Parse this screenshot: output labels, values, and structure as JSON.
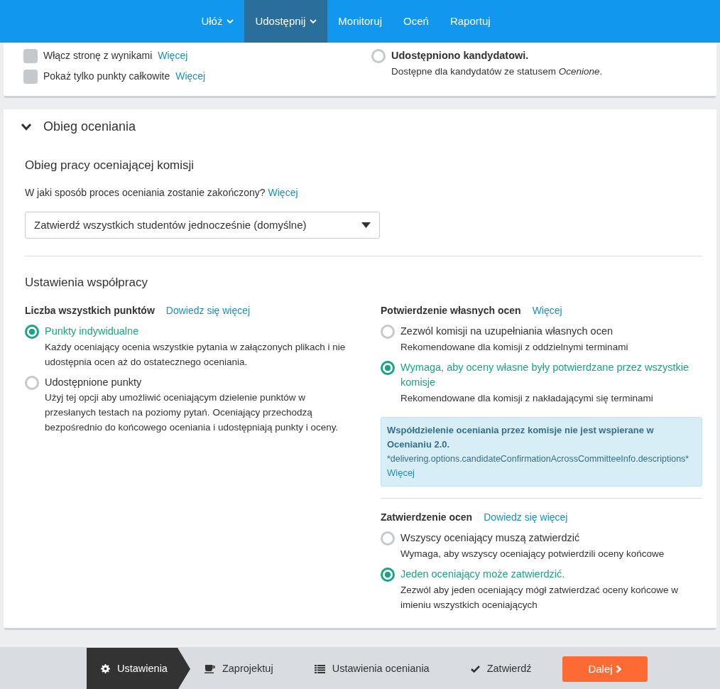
{
  "nav": {
    "items": [
      {
        "label": "Ułóż",
        "dropdown": true,
        "selected": false
      },
      {
        "label": "Udostępnij",
        "dropdown": true,
        "selected": true
      },
      {
        "label": "Monitoruj",
        "dropdown": false,
        "selected": false
      },
      {
        "label": "Oceń",
        "dropdown": false,
        "selected": false
      },
      {
        "label": "Raportuj",
        "dropdown": false,
        "selected": false
      }
    ]
  },
  "results_card": {
    "checkboxes": [
      {
        "label": "Włącz stronę z wynikami",
        "link": "Więcej",
        "checked": false
      },
      {
        "label": "Pokaż tylko punkty całkowite",
        "link": "Więcej",
        "checked": false
      }
    ],
    "radio": {
      "label": "Udostępniono kandydatowi.",
      "description": "Dostępne dla kandydatów ze statusem *Ocenione*.",
      "selected": false
    }
  },
  "section": {
    "title": "Obieg oceniania",
    "expanded": true,
    "workflow": {
      "heading": "Obieg pracy oceniającej komisji",
      "question": "W jaki sposób proces oceniania zostanie zakończony?",
      "link": "Więcej",
      "select_value": "Zatwierdź wszystkich studentów jednocześnie (domyślne)"
    },
    "collaboration": {
      "heading": "Ustawienia współpracy",
      "groups": [
        {
          "title": "Liczba wszystkich punktów",
          "link": "Dowiedz się więcej",
          "options": [
            {
              "label": "Punkty indywidualne",
              "description": "Każdy oceniający ocenia wszystkie pytania w załączonych plikach i nie udostępnia ocen aż do ostatecznego oceniania.",
              "selected": true
            },
            {
              "label": "Udostępnione punkty",
              "description": "Użyj tej opcji aby umożliwić oceniającym dzielenie punktów w przesłanych testach na poziomy pytań. Oceniający przechodzą bezpośrednio do końcowego oceniania i udostępniają punkty i oceny.",
              "selected": false
            }
          ]
        },
        {
          "title": "Potwierdzenie własnych ocen",
          "link": "Więcej",
          "options": [
            {
              "label": "Zezwól komisji na uzupełniania własnych ocen",
              "description": "Rekomendowane dla komisji z oddzielnymi terminami",
              "selected": false
            },
            {
              "label": "Wymaga, aby oceny własne były potwierdzane przez wszystkie komisje",
              "description": "Rekomendowane dla komisji z nakładającymi się terminami",
              "selected": true
            }
          ],
          "alert": {
            "title": "Współdzielenie oceniania przez komisje nie jest wspierane w Ocenianiu 2.0.",
            "text": "*delivering.options.candidateConfirmationAcrossCommitteeInfo.descriptions*",
            "link": "Więcej"
          }
        },
        {
          "title": "Zatwierdzenie ocen",
          "link": "Dowiedz się więcej",
          "options": [
            {
              "label": "Wszyscy oceniający muszą zatwierdzić",
              "description": "Wymaga, aby wszyscy oceniający potwierdzili oceny końcowe",
              "selected": false
            },
            {
              "label": "Jeden oceniający może zatwierdzić.",
              "description": "Zezwól aby jeden oceniający mógł zatwierdzać oceny końcowe w imieniu wszystkich oceniających",
              "selected": true
            }
          ]
        }
      ]
    }
  },
  "footer": {
    "steps": [
      {
        "label": "Ustawienia",
        "kind": "settings",
        "selected": true
      },
      {
        "label": "Zaprojektuj",
        "kind": "design",
        "selected": false
      },
      {
        "label": "Ustawienia oceniania",
        "kind": "grading",
        "selected": false
      },
      {
        "label": "Zatwierdź",
        "kind": "confirm",
        "selected": false
      }
    ],
    "next_button": "Dalej"
  }
}
